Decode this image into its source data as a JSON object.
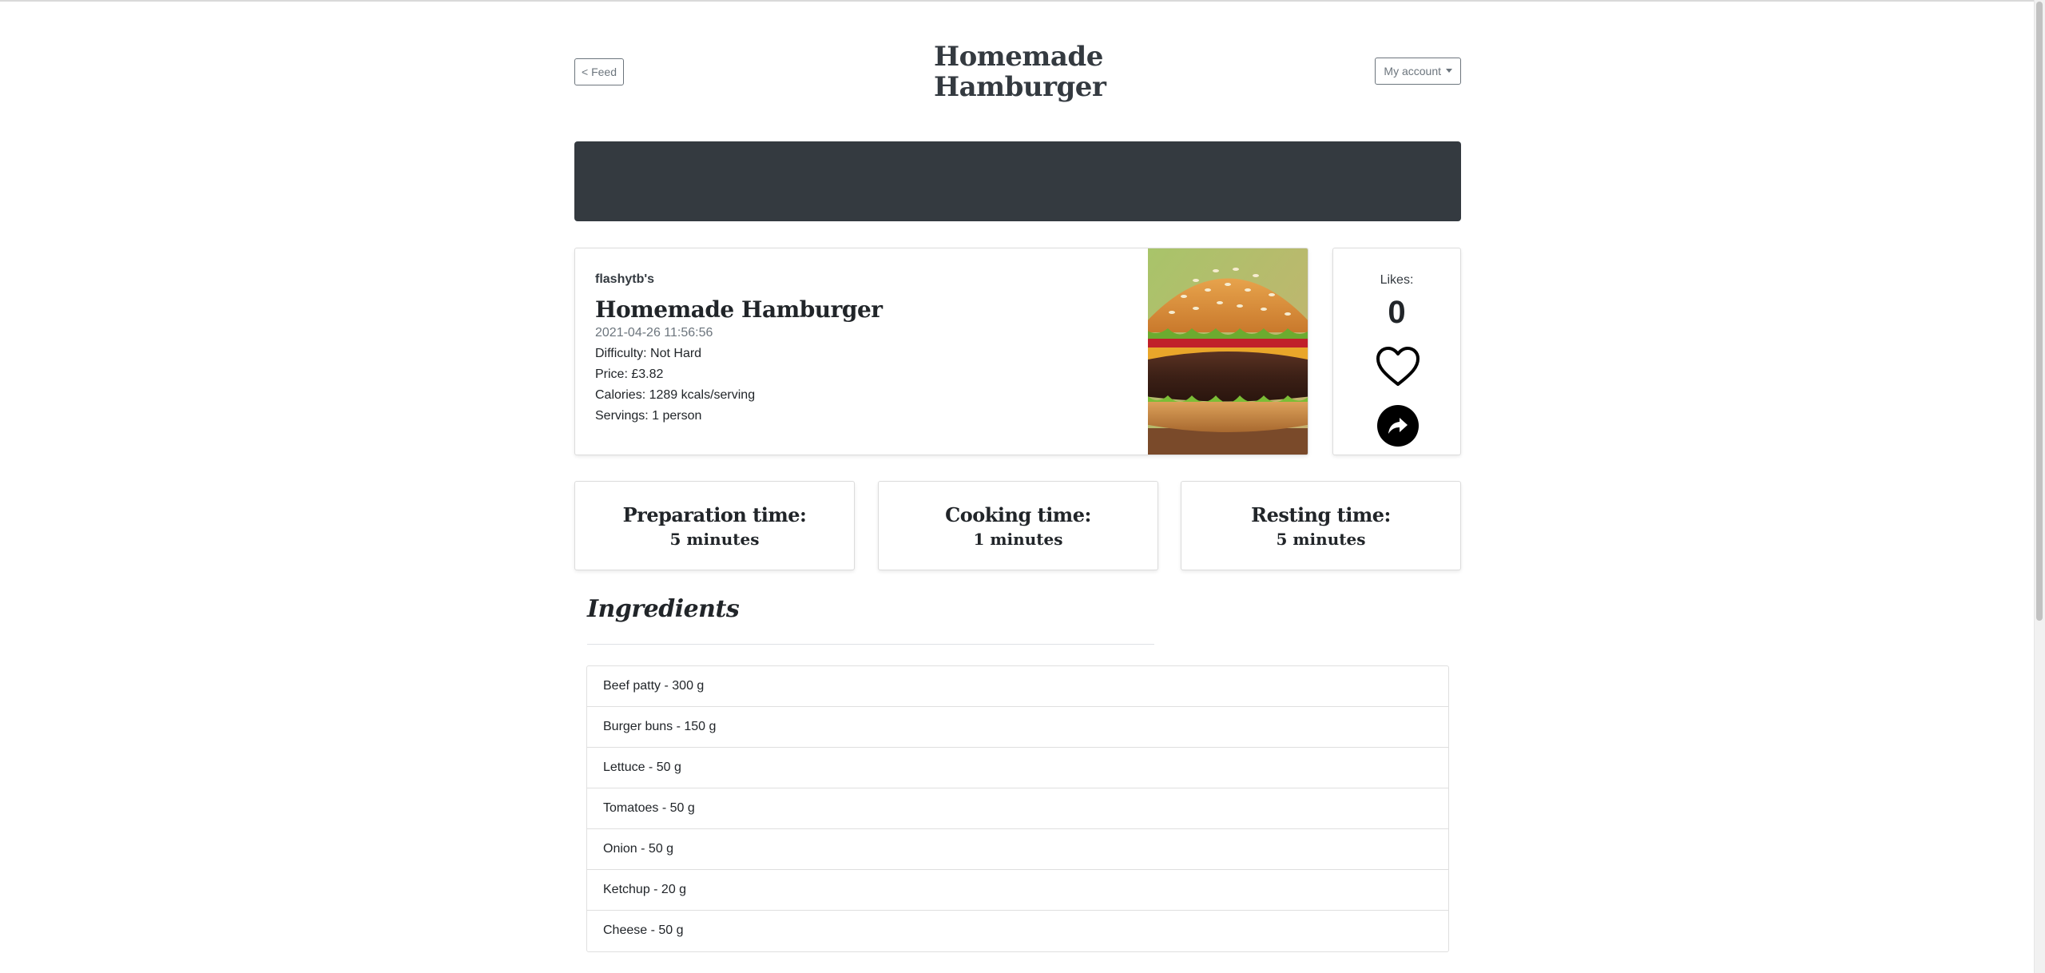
{
  "header": {
    "feed_label": "< Feed",
    "title": "Homemade Hamburger",
    "account_label": "My account"
  },
  "recipe": {
    "author": "flashytb's",
    "name": "Homemade Hamburger",
    "date": "2021-04-26 11:56:56",
    "difficulty": "Difficulty: Not Hard",
    "price": "Price: £3.82",
    "calories": "Calories: 1289 kcals/serving",
    "servings": "Servings: 1 person"
  },
  "likes": {
    "label": "Likes:",
    "count": "0"
  },
  "times": [
    {
      "label": "Preparation time:",
      "value": "5 minutes"
    },
    {
      "label": "Cooking time:",
      "value": "1 minutes"
    },
    {
      "label": "Resting time:",
      "value": "5 minutes"
    }
  ],
  "ingredients": {
    "title": "Ingredients",
    "items": [
      "Beef patty - 300 g",
      "Burger buns - 150 g",
      "Lettuce - 50 g",
      "Tomatoes - 50 g",
      "Onion - 50 g",
      "Ketchup - 20 g",
      "Cheese - 50 g"
    ]
  },
  "colors": {
    "banner": "#343a40",
    "text": "#212529",
    "muted": "#6c757d"
  },
  "icons": {
    "like": "heart-outline-icon",
    "share": "share-arrow-icon",
    "account_dropdown": "caret-down-icon"
  }
}
